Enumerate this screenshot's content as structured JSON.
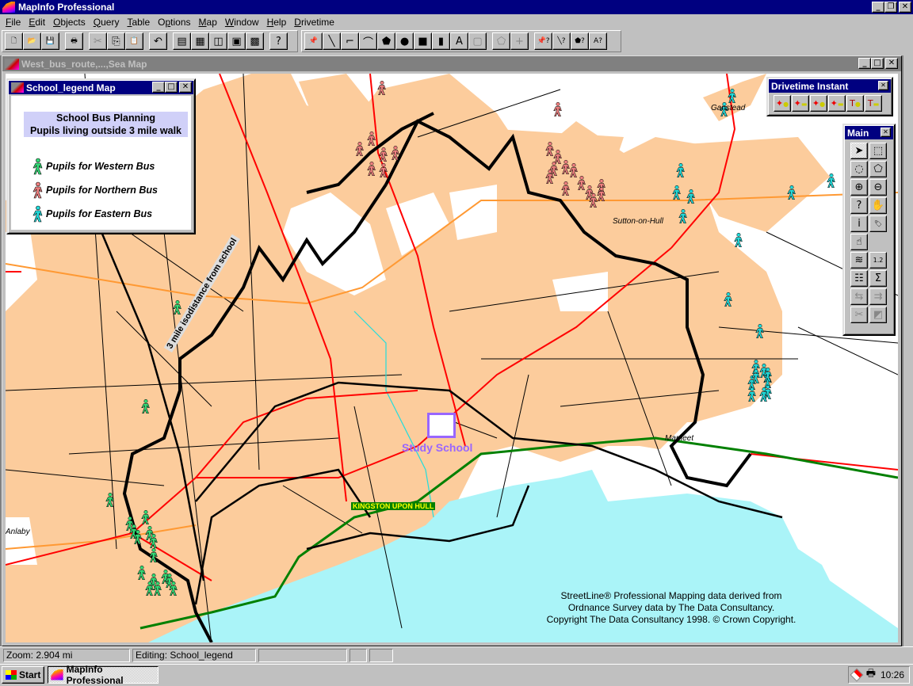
{
  "app": {
    "title": "MapInfo Professional"
  },
  "menu": [
    "File",
    "Edit",
    "Objects",
    "Query",
    "Table",
    "Options",
    "Map",
    "Window",
    "Help",
    "Drivetime"
  ],
  "menu_underline": [
    "F",
    "E",
    "O",
    "Q",
    "T",
    "p",
    "M",
    "W",
    "H",
    "D"
  ],
  "toolbar_standard": [
    {
      "name": "new-icon",
      "glyph": "🗋"
    },
    {
      "name": "open-icon",
      "glyph": "📂"
    },
    {
      "name": "save-icon",
      "glyph": "💾"
    },
    {
      "name": "print-icon",
      "glyph": "🖶"
    },
    {
      "name": "cut-icon",
      "glyph": "✂"
    },
    {
      "name": "copy-icon",
      "glyph": "⎘"
    },
    {
      "name": "paste-icon",
      "glyph": "📋"
    },
    {
      "name": "undo-icon",
      "glyph": "↶"
    },
    {
      "name": "browser-icon",
      "glyph": "▤"
    },
    {
      "name": "map-window-icon",
      "glyph": "▦"
    },
    {
      "name": "graph-icon",
      "glyph": "◫"
    },
    {
      "name": "layout-icon",
      "glyph": "▣"
    },
    {
      "name": "redistrict-icon",
      "glyph": "▩"
    },
    {
      "name": "help-icon",
      "glyph": "?"
    }
  ],
  "toolbar_drawing": [
    {
      "name": "symbol-icon",
      "glyph": "📌"
    },
    {
      "name": "line-icon",
      "glyph": "╲"
    },
    {
      "name": "polyline-icon",
      "glyph": "⌐"
    },
    {
      "name": "arc-icon",
      "glyph": "⌒"
    },
    {
      "name": "polygon-icon",
      "glyph": "⬟"
    },
    {
      "name": "ellipse-icon",
      "glyph": "●"
    },
    {
      "name": "rectangle-icon",
      "glyph": "■"
    },
    {
      "name": "rounded-rect-icon",
      "glyph": "▮"
    },
    {
      "name": "text-icon",
      "glyph": "A"
    },
    {
      "name": "frame-icon",
      "glyph": "▢"
    },
    {
      "name": "reshape-icon",
      "glyph": "⬠"
    },
    {
      "name": "add-node-icon",
      "glyph": "+"
    },
    {
      "name": "symbol-style-icon",
      "glyph": "📌?"
    },
    {
      "name": "line-style-icon",
      "glyph": "╲?"
    },
    {
      "name": "region-style-icon",
      "glyph": "⬟?"
    },
    {
      "name": "text-style-icon",
      "glyph": "A?"
    }
  ],
  "map_window": {
    "title": "West_bus_route,...,Sea Map"
  },
  "legend_window": {
    "title": "School_legend Map",
    "heading_line1": "School Bus Planning",
    "heading_line2": "Pupils living outside 3 mile walk",
    "items": [
      {
        "label": "Pupils for Western Bus",
        "color": "#33dd77"
      },
      {
        "label": "Pupils for Northern Bus",
        "color": "#f08080"
      },
      {
        "label": "Pupils for Eastern Bus",
        "color": "#22dddd"
      }
    ]
  },
  "drivetime_window": {
    "title": "Drivetime Instant",
    "buttons": [
      "drivetime-time-icon",
      "drivetime-distance-icon",
      "drivetime-select-time-icon",
      "drivetime-select-distance-icon",
      "drivetime-route-time-icon",
      "drivetime-route-distance-icon"
    ]
  },
  "main_toolbar": {
    "title": "Main",
    "buttons": [
      {
        "name": "select-icon",
        "glyph": "➤"
      },
      {
        "name": "marquee-select-icon",
        "glyph": "⬚"
      },
      {
        "name": "radius-select-icon",
        "glyph": "◌"
      },
      {
        "name": "polygon-select-icon",
        "glyph": "⬠"
      },
      {
        "name": "zoom-in-icon",
        "glyph": "⊕"
      },
      {
        "name": "zoom-out-icon",
        "glyph": "⊖"
      },
      {
        "name": "change-view-icon",
        "glyph": "?"
      },
      {
        "name": "grabber-icon",
        "glyph": "✋"
      },
      {
        "name": "info-icon",
        "glyph": "i"
      },
      {
        "name": "label-icon",
        "glyph": "🏷"
      },
      {
        "name": "drag-window-icon",
        "glyph": "☝"
      },
      {
        "name": "layer-control-icon",
        "glyph": "≋"
      },
      {
        "name": "ruler-icon",
        "glyph": "1.2"
      },
      {
        "name": "legend-icon",
        "glyph": "☷"
      },
      {
        "name": "statistics-icon",
        "glyph": "Σ"
      },
      {
        "name": "hotlink-icon",
        "glyph": "⇆"
      },
      {
        "name": "boundary-select-icon",
        "glyph": "⇉"
      },
      {
        "name": "clip-region-icon",
        "glyph": "✂"
      },
      {
        "name": "set-target-icon",
        "glyph": "◩"
      }
    ]
  },
  "map": {
    "place_labels": [
      "Ganstead",
      "Sutton-on-Hull",
      "Marfleet",
      "Anlaby"
    ],
    "city_label": "KINGSTON UPON HULL",
    "school_label": "Study School",
    "isodistance_label": "3 mile isodistance from school",
    "copyright": [
      "StreetLine® Professional Mapping data derived from",
      "Ordnance Survey data by The Data Consultancy.",
      "Copyright The Data Consultancy 1998. © Crown Copyright."
    ],
    "colors": {
      "urban": "#fccc9c",
      "water": "#aaf4f8",
      "main_road": "#ff0000",
      "ring_road": "#ff9933",
      "rail": "#008000",
      "isodistance": "#000000",
      "school": "#9966ff",
      "river": "#22dddd"
    },
    "pupils": {
      "western": 17,
      "northern": 20,
      "eastern": 20
    }
  },
  "status": {
    "zoom": "Zoom: 2.904 mi",
    "editing": "Editing: School_legend"
  },
  "taskbar": {
    "start": "Start",
    "task": "MapInfo Professional",
    "clock": "10:26"
  }
}
